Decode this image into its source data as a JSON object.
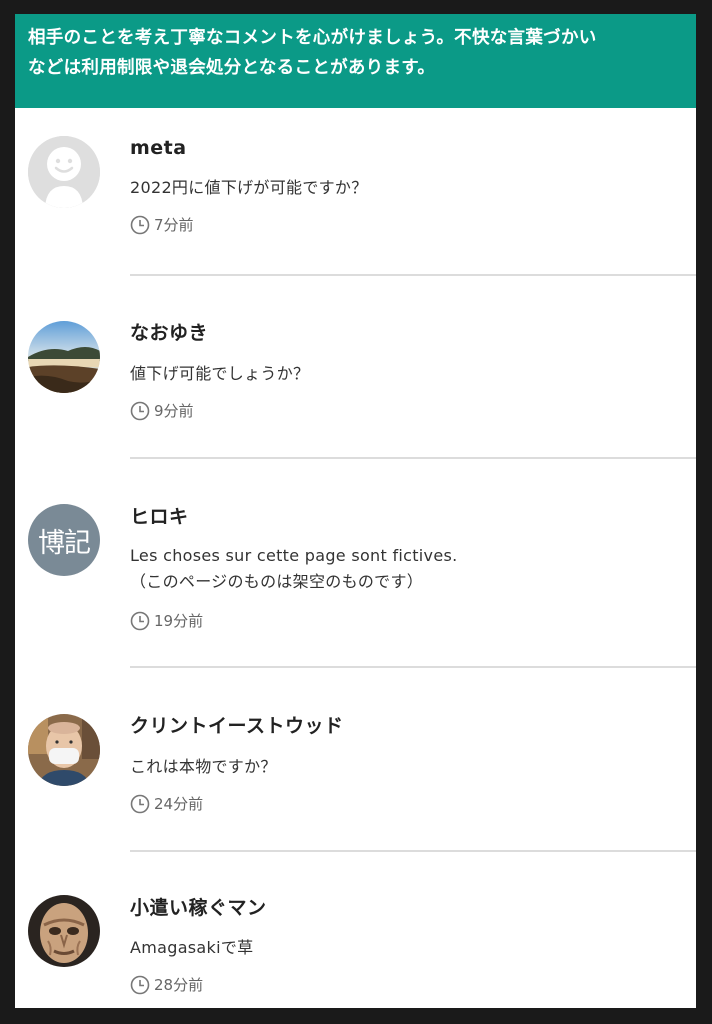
{
  "notice": {
    "line1": "相手のことを考え丁寧なコメントを心がけましょう。不快な言葉づかい",
    "line2": "などは利用制限や退会処分となることがあります。"
  },
  "colors": {
    "notice_bg": "#0b9a87",
    "divider": "#dcdcdc",
    "avatar_default_bg": "#dddddd",
    "avatar_text_bg": "#7a8a96"
  },
  "comments": [
    {
      "name": "meta",
      "text": [
        "2022円に値下げが可能ですか？"
      ],
      "time": "7分前",
      "avatar": "default-user-icon"
    },
    {
      "name": "なおゆき",
      "text": [
        "値下げ可能でしょうか？"
      ],
      "time": "9分前",
      "avatar": "landscape-photo"
    },
    {
      "name": "ヒロキ",
      "text": [
        "Les choses sur cette page sont fictives.",
        "（このページのものは架空のものです）"
      ],
      "time": "19分前",
      "avatar": "text-avatar",
      "avatar_text": "博記"
    },
    {
      "name": "クリントイーストウッド",
      "text": [
        "これは本物ですか？"
      ],
      "time": "24分前",
      "avatar": "person-photo"
    },
    {
      "name": "小遣い稼ぐマン",
      "text": [
        "Amagasakiで草"
      ],
      "time": "28分前",
      "avatar": "mask-photo"
    }
  ]
}
